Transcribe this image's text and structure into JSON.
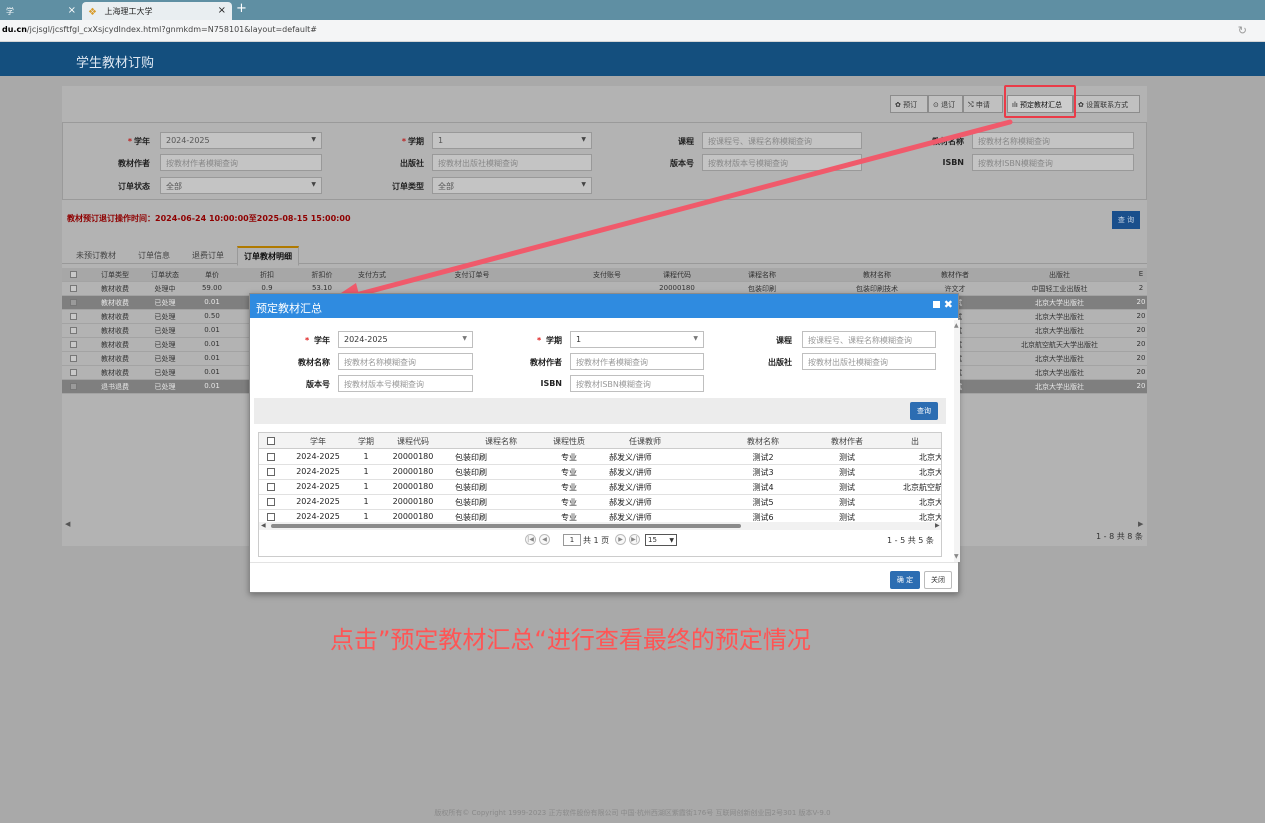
{
  "browser": {
    "tabs": [
      {
        "label": "学"
      },
      {
        "label": "上海理工大学"
      }
    ],
    "new_tab": "+",
    "url_domain": "du.cn",
    "url_path": "/jcjsgl/jcsftfgl_cxXsjcydIndex.html?gnmkdm=N758101&layout=default#"
  },
  "app": {
    "title": "学生教材订购"
  },
  "toolbar": [
    {
      "label": "✿ 预订"
    },
    {
      "label": "⊙ 退订"
    },
    {
      "label": "⤭ 申请"
    },
    {
      "label": "ılı 预定教材汇总"
    },
    {
      "label": "✿ 设置联系方式"
    }
  ],
  "filters": {
    "xn_label": "学年",
    "xn_value": "2024-2025",
    "xq_label": "学期",
    "xq_value": "1",
    "kc_label": "课程",
    "kc_ph": "按课程号、课程名称模糊查询",
    "jcmc_label": "教材名称",
    "jcmc_ph": "按教材名称模糊查询",
    "jczz_label": "教材作者",
    "jczz_ph": "按教材作者模糊查询",
    "cbs_label": "出版社",
    "cbs_ph": "按教材出版社模糊查询",
    "bbh_label": "版本号",
    "bbh_ph": "按教材版本号模糊查询",
    "isbn_label": "ISBN",
    "isbn_ph": "按教材ISBN模糊查询",
    "ddzt_label": "订单状态",
    "ddzt_value": "全部",
    "ddlx_label": "订单类型",
    "ddlx_value": "全部"
  },
  "notice": "教材预订退订操作时间：2024-06-24 10:00:00至2025-08-15 15:00:00",
  "query_label": "查 询",
  "subtabs": [
    "未预订教材",
    "订单信息",
    "退费订单",
    "订单教材明细"
  ],
  "bg_table": {
    "headers": [
      "订单类型",
      "订单状态",
      "单价",
      "折扣",
      "折扣价",
      "支付方式",
      "支付订单号",
      "支付账号",
      "课程代码",
      "课程名称",
      "教材名称",
      "教材作者",
      "出版社",
      "E"
    ],
    "rows": [
      {
        "type": "教材收费",
        "status": "处理中",
        "price": "59.00",
        "disc": "0.9",
        "dprice": "53.10",
        "code": "20000180",
        "kcmc": "包装印刷",
        "jcmc": "包装印刷技术",
        "author": "许文才",
        "pub": "中国轻工业出版社",
        "e": "2",
        "sel": false
      },
      {
        "type": "教材收费",
        "status": "已处理",
        "price": "0.01",
        "author": "测试",
        "pub": "北京大学出版社",
        "e": "20",
        "sel": true
      },
      {
        "type": "教材收费",
        "status": "已处理",
        "price": "0.50",
        "author": "测试",
        "pub": "北京大学出版社",
        "e": "20",
        "sel": false
      },
      {
        "type": "教材收费",
        "status": "已处理",
        "price": "0.01",
        "author": "测试",
        "pub": "北京大学出版社",
        "e": "20",
        "sel": false
      },
      {
        "type": "教材收费",
        "status": "已处理",
        "price": "0.01",
        "author": "测试",
        "pub": "北京航空航天大学出版社",
        "e": "20",
        "sel": false
      },
      {
        "type": "教材收费",
        "status": "已处理",
        "price": "0.01",
        "author": "测试",
        "pub": "北京大学出版社",
        "e": "20",
        "sel": false
      },
      {
        "type": "教材收费",
        "status": "已处理",
        "price": "0.01",
        "author": "测试",
        "pub": "北京大学出版社",
        "e": "20",
        "sel": false
      },
      {
        "type": "退书退费",
        "status": "已处理",
        "price": "0.01",
        "author": "测试",
        "pub": "北京大学出版社",
        "e": "20",
        "sel": true
      }
    ],
    "pager": "1 - 8   共 8 条"
  },
  "modal": {
    "title": "预定教材汇总",
    "xn_label": "学年",
    "xn_value": "2024-2025",
    "xq_label": "学期",
    "xq_value": "1",
    "kc_label": "课程",
    "kc_ph": "按课程号、课程名称模糊查询",
    "jcmc_label": "教材名称",
    "jcmc_ph": "按教材名称模糊查询",
    "jczz_label": "教材作者",
    "jczz_ph": "按教材作者模糊查询",
    "cbs_label": "出版社",
    "cbs_ph": "按教材出版社模糊查询",
    "bbh_label": "版本号",
    "bbh_ph": "按教材版本号模糊查询",
    "isbn_label": "ISBN",
    "isbn_ph": "按教材ISBN模糊查询",
    "query_label": "查询",
    "headers": [
      "学年",
      "学期",
      "课程代码",
      "课程名称",
      "课程性质",
      "任课教师",
      "教材名称",
      "教材作者",
      "出"
    ],
    "rows": [
      {
        "xn": "2024-2025",
        "xq": "1",
        "code": "20000180",
        "kcmc": "包装印刷",
        "xz": "专业",
        "teacher": "郝发义/讲师",
        "jc": "测试2",
        "author": "测试",
        "pub": "北京大"
      },
      {
        "xn": "2024-2025",
        "xq": "1",
        "code": "20000180",
        "kcmc": "包装印刷",
        "xz": "专业",
        "teacher": "郝发义/讲师",
        "jc": "测试3",
        "author": "测试",
        "pub": "北京大"
      },
      {
        "xn": "2024-2025",
        "xq": "1",
        "code": "20000180",
        "kcmc": "包装印刷",
        "xz": "专业",
        "teacher": "郝发义/讲师",
        "jc": "测试4",
        "author": "测试",
        "pub": "北京航空航"
      },
      {
        "xn": "2024-2025",
        "xq": "1",
        "code": "20000180",
        "kcmc": "包装印刷",
        "xz": "专业",
        "teacher": "郝发义/讲师",
        "jc": "测试5",
        "author": "测试",
        "pub": "北京大"
      },
      {
        "xn": "2024-2025",
        "xq": "1",
        "code": "20000180",
        "kcmc": "包装印刷",
        "xz": "专业",
        "teacher": "郝发义/讲师",
        "jc": "测试6",
        "author": "测试",
        "pub": "北京大"
      }
    ],
    "pager": {
      "page_input": "1",
      "total_pages": "共 1 页",
      "page_size": "15",
      "summary": "1 - 5   共 5 条"
    },
    "ok_label": "确 定",
    "cancel_label": "关闭"
  },
  "instruction": "点击”预定教材汇总“进行查看最终的预定情况",
  "footer": "版权所有© Copyright 1999-2023 正方软件股份有限公司    中国·杭州西湖区紫霞街176号 互联网创新创业园2号301   版本V-9.0",
  "colors": {
    "accent": "#2f8be0",
    "header": "#144f7e",
    "highlight": "#ea3b48",
    "instruction": "#ff5555"
  }
}
